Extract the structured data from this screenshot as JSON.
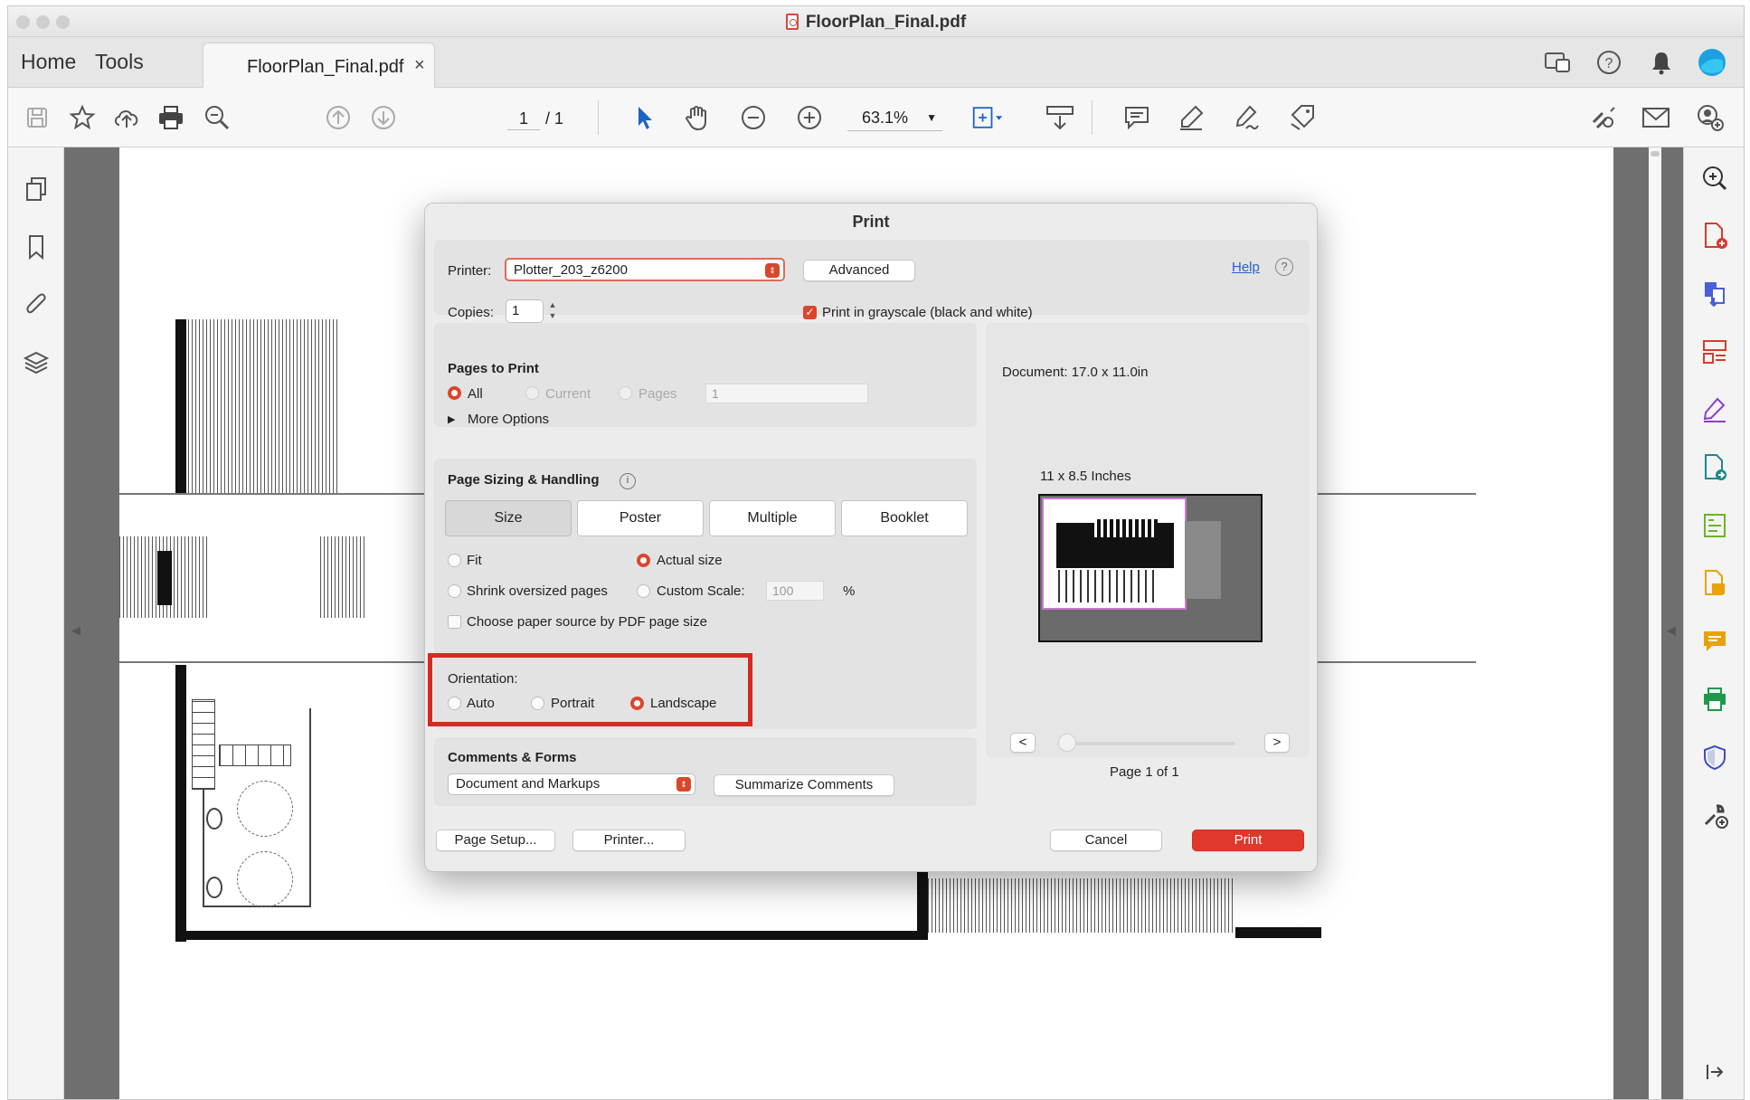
{
  "window": {
    "title": "FloorPlan_Final.pdf"
  },
  "nav": {
    "home": "Home",
    "tools": "Tools",
    "doc_tab": "FloorPlan_Final.pdf",
    "doc_tab_close": "×"
  },
  "toolbar": {
    "page_current": "1",
    "page_total": "/ 1",
    "zoom": "63.1%"
  },
  "dialog": {
    "title": "Print",
    "printer_label": "Printer:",
    "printer_value": "Plotter_203_z6200",
    "advanced": "Advanced",
    "help": "Help",
    "copies_label": "Copies:",
    "copies_value": "1",
    "grayscale_label": "Print in grayscale (black and white)",
    "grayscale_checked": true,
    "pages_to_print": {
      "heading": "Pages to Print",
      "all": "All",
      "current": "Current",
      "pages": "Pages",
      "pages_value": "1",
      "selected": "All",
      "more_options": "More Options"
    },
    "sizing": {
      "heading": "Page Sizing & Handling",
      "tabs": [
        "Size",
        "Poster",
        "Multiple",
        "Booklet"
      ],
      "active_tab": "Size",
      "fit": "Fit",
      "actual_size": "Actual size",
      "shrink": "Shrink oversized pages",
      "custom_scale": "Custom Scale:",
      "custom_scale_value": "100",
      "percent": "%",
      "paper_source": "Choose paper source by PDF page size",
      "selected": "Actual size"
    },
    "orientation": {
      "heading": "Orientation:",
      "auto": "Auto",
      "portrait": "Portrait",
      "landscape": "Landscape",
      "selected": "Landscape"
    },
    "comments": {
      "heading": "Comments & Forms",
      "value": "Document and Markups",
      "summarize": "Summarize Comments"
    },
    "preview": {
      "document_size": "Document: 17.0 x 11.0in",
      "paper_size": "11 x 8.5 Inches",
      "prev": "<",
      "next": ">",
      "page_label": "Page 1 of 1"
    },
    "buttons": {
      "page_setup": "Page Setup...",
      "printer": "Printer...",
      "cancel": "Cancel",
      "print": "Print"
    }
  },
  "colors": {
    "accent": "#d9472b",
    "highlight": "#d42a22",
    "print_button": "#e0392b",
    "link": "#2a5fc7"
  }
}
